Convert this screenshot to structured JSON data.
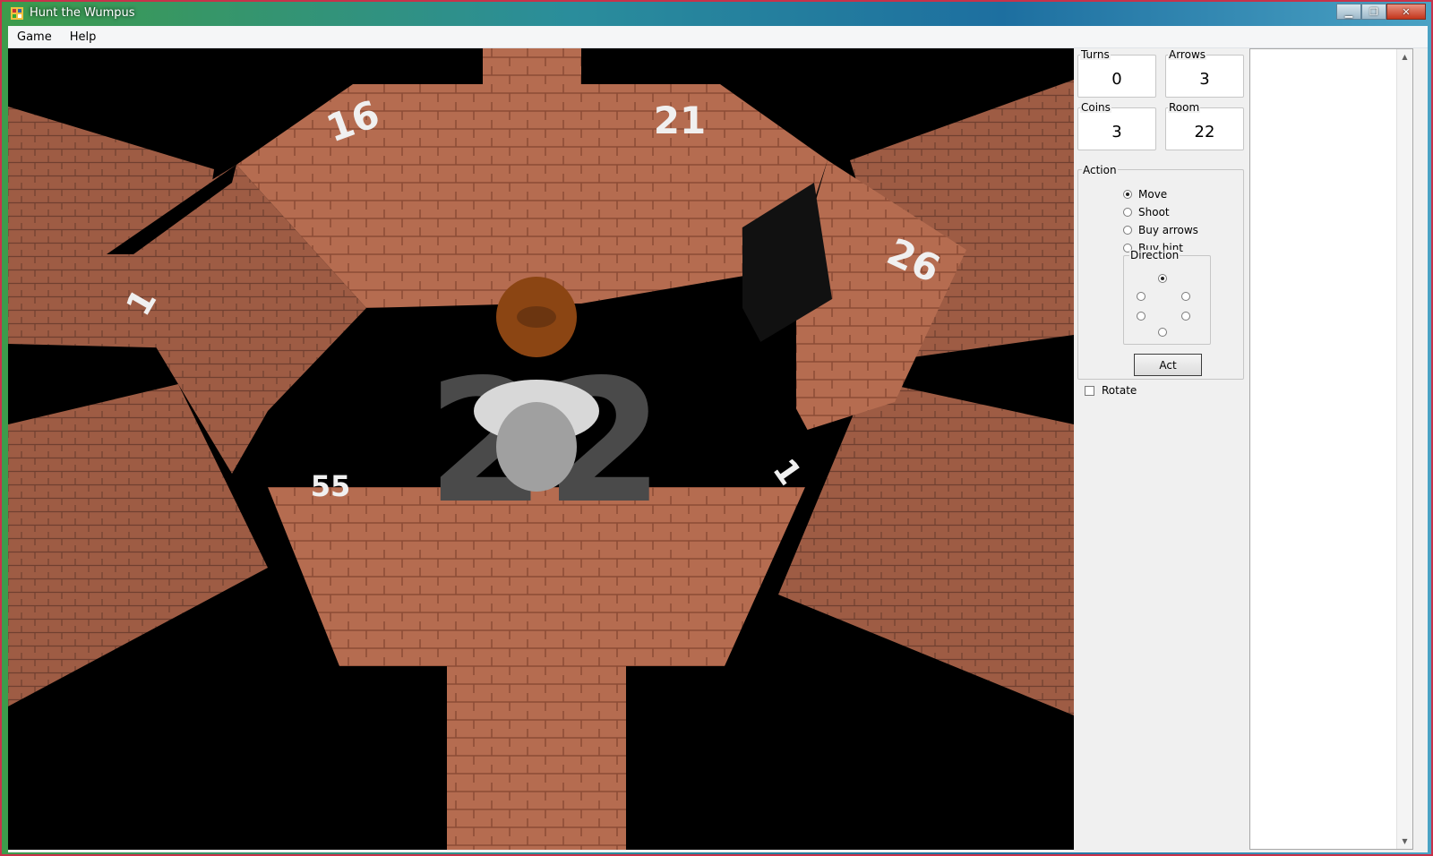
{
  "window": {
    "title": "Hunt the Wumpus",
    "buttons": [
      "▁",
      "❐",
      "✕"
    ]
  },
  "menu": {
    "items": [
      "Game",
      "Help"
    ]
  },
  "scene": {
    "room_labels": [
      "16",
      "21",
      "26",
      "22"
    ],
    "partial_labels": [
      "1",
      "55",
      "1"
    ],
    "colors": {
      "brick": "#b56c50",
      "brick_dark": "#8b4b36",
      "floor": "#000000"
    }
  },
  "stats": {
    "turns": {
      "label": "Turns",
      "value": "0"
    },
    "arrows": {
      "label": "Arrows",
      "value": "3"
    },
    "coins": {
      "label": "Coins",
      "value": "3"
    },
    "room": {
      "label": "Room",
      "value": "22"
    }
  },
  "action": {
    "label": "Action",
    "options": [
      {
        "label": "Move",
        "checked": true
      },
      {
        "label": "Shoot",
        "checked": false
      },
      {
        "label": "Buy arrows",
        "checked": false
      },
      {
        "label": "Buy hint",
        "checked": false
      }
    ],
    "direction": {
      "label": "Direction",
      "selected": "north"
    },
    "act_label": "Act"
  },
  "rotate": {
    "label": "Rotate",
    "checked": false
  }
}
